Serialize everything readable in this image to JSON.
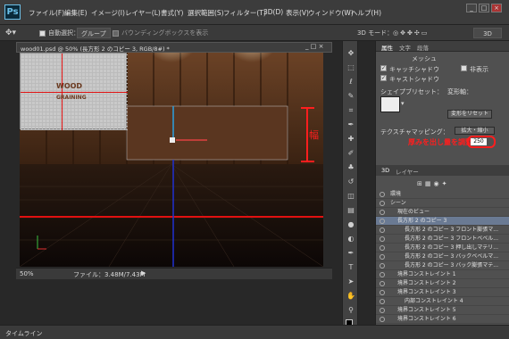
{
  "app": {
    "logo": "Ps",
    "menu": [
      "ファイル(F)",
      "編集(E)",
      "イメージ(I)",
      "レイヤー(L)",
      "書式(Y)",
      "選択範囲(S)",
      "フィルター(T)",
      "3D(D)",
      "表示(V)",
      "ウィンドウ(W)",
      "ヘルプ(H)"
    ],
    "window_buttons": [
      "_",
      "□",
      "×"
    ]
  },
  "options": {
    "auto_select_label": "自動選択：",
    "group_label": "グループ",
    "bbox_label": "バウンディングボックスを表示",
    "mode_label": "3D モード：",
    "workspace": "3D"
  },
  "document": {
    "tab_title": "wood01.psd @ 50% (長方形 2 のコピー 3, RGB/8#) *",
    "canvas_text_line1": "WOOD",
    "canvas_text_line2": "GRAINING",
    "zoom": "50%",
    "file_info": "ファイル：3.48M/7.43M"
  },
  "properties": {
    "tabs": [
      "属性",
      "文字",
      "段落"
    ],
    "mesh_label": "メッシュ",
    "catch_shadow": "キャッチシャドウ",
    "cast_shadow": "キャストシャドウ",
    "invisible": "非表示",
    "shape_preset_label": "シェイプブリセット：",
    "deform_label": "変形軸：",
    "reset_deform_button": "変形をリセット",
    "texture_mapping_label": "テクスチャマッピング：",
    "texture_mapping_value": "拡大・縮小",
    "annotation": "厚みを出し量を調整",
    "depth_value": "250"
  },
  "layers": {
    "tabs": [
      "3D",
      "レイヤー"
    ],
    "rows": [
      {
        "label": "環境",
        "indent": 0
      },
      {
        "label": "シーン",
        "indent": 0
      },
      {
        "label": "現在のビュー",
        "indent": 1
      },
      {
        "label": "長方形 2 のコピー 3",
        "indent": 1,
        "selected": true
      },
      {
        "label": "長方形 2 のコピー 3 フロント膨張マ...",
        "indent": 2
      },
      {
        "label": "長方形 2 のコピー 3 フロントベベル...",
        "indent": 2
      },
      {
        "label": "長方形 2 のコピー 3 押し出しマテリ...",
        "indent": 2
      },
      {
        "label": "長方形 2 のコピー 3 バックベベルマ...",
        "indent": 2
      },
      {
        "label": "長方形 2 のコピー 3 バック膨張マテ...",
        "indent": 2
      },
      {
        "label": "境界コンストレイント 1",
        "indent": 1
      },
      {
        "label": "境界コンストレイント 2",
        "indent": 1
      },
      {
        "label": "境界コンストレイント 3",
        "indent": 1
      },
      {
        "label": "内部コンストレイント 4",
        "indent": 2
      },
      {
        "label": "境界コンストレイント 5",
        "indent": 1
      },
      {
        "label": "境界コンストレイント 6",
        "indent": 1
      }
    ]
  },
  "timeline_label": "タイムライン"
}
